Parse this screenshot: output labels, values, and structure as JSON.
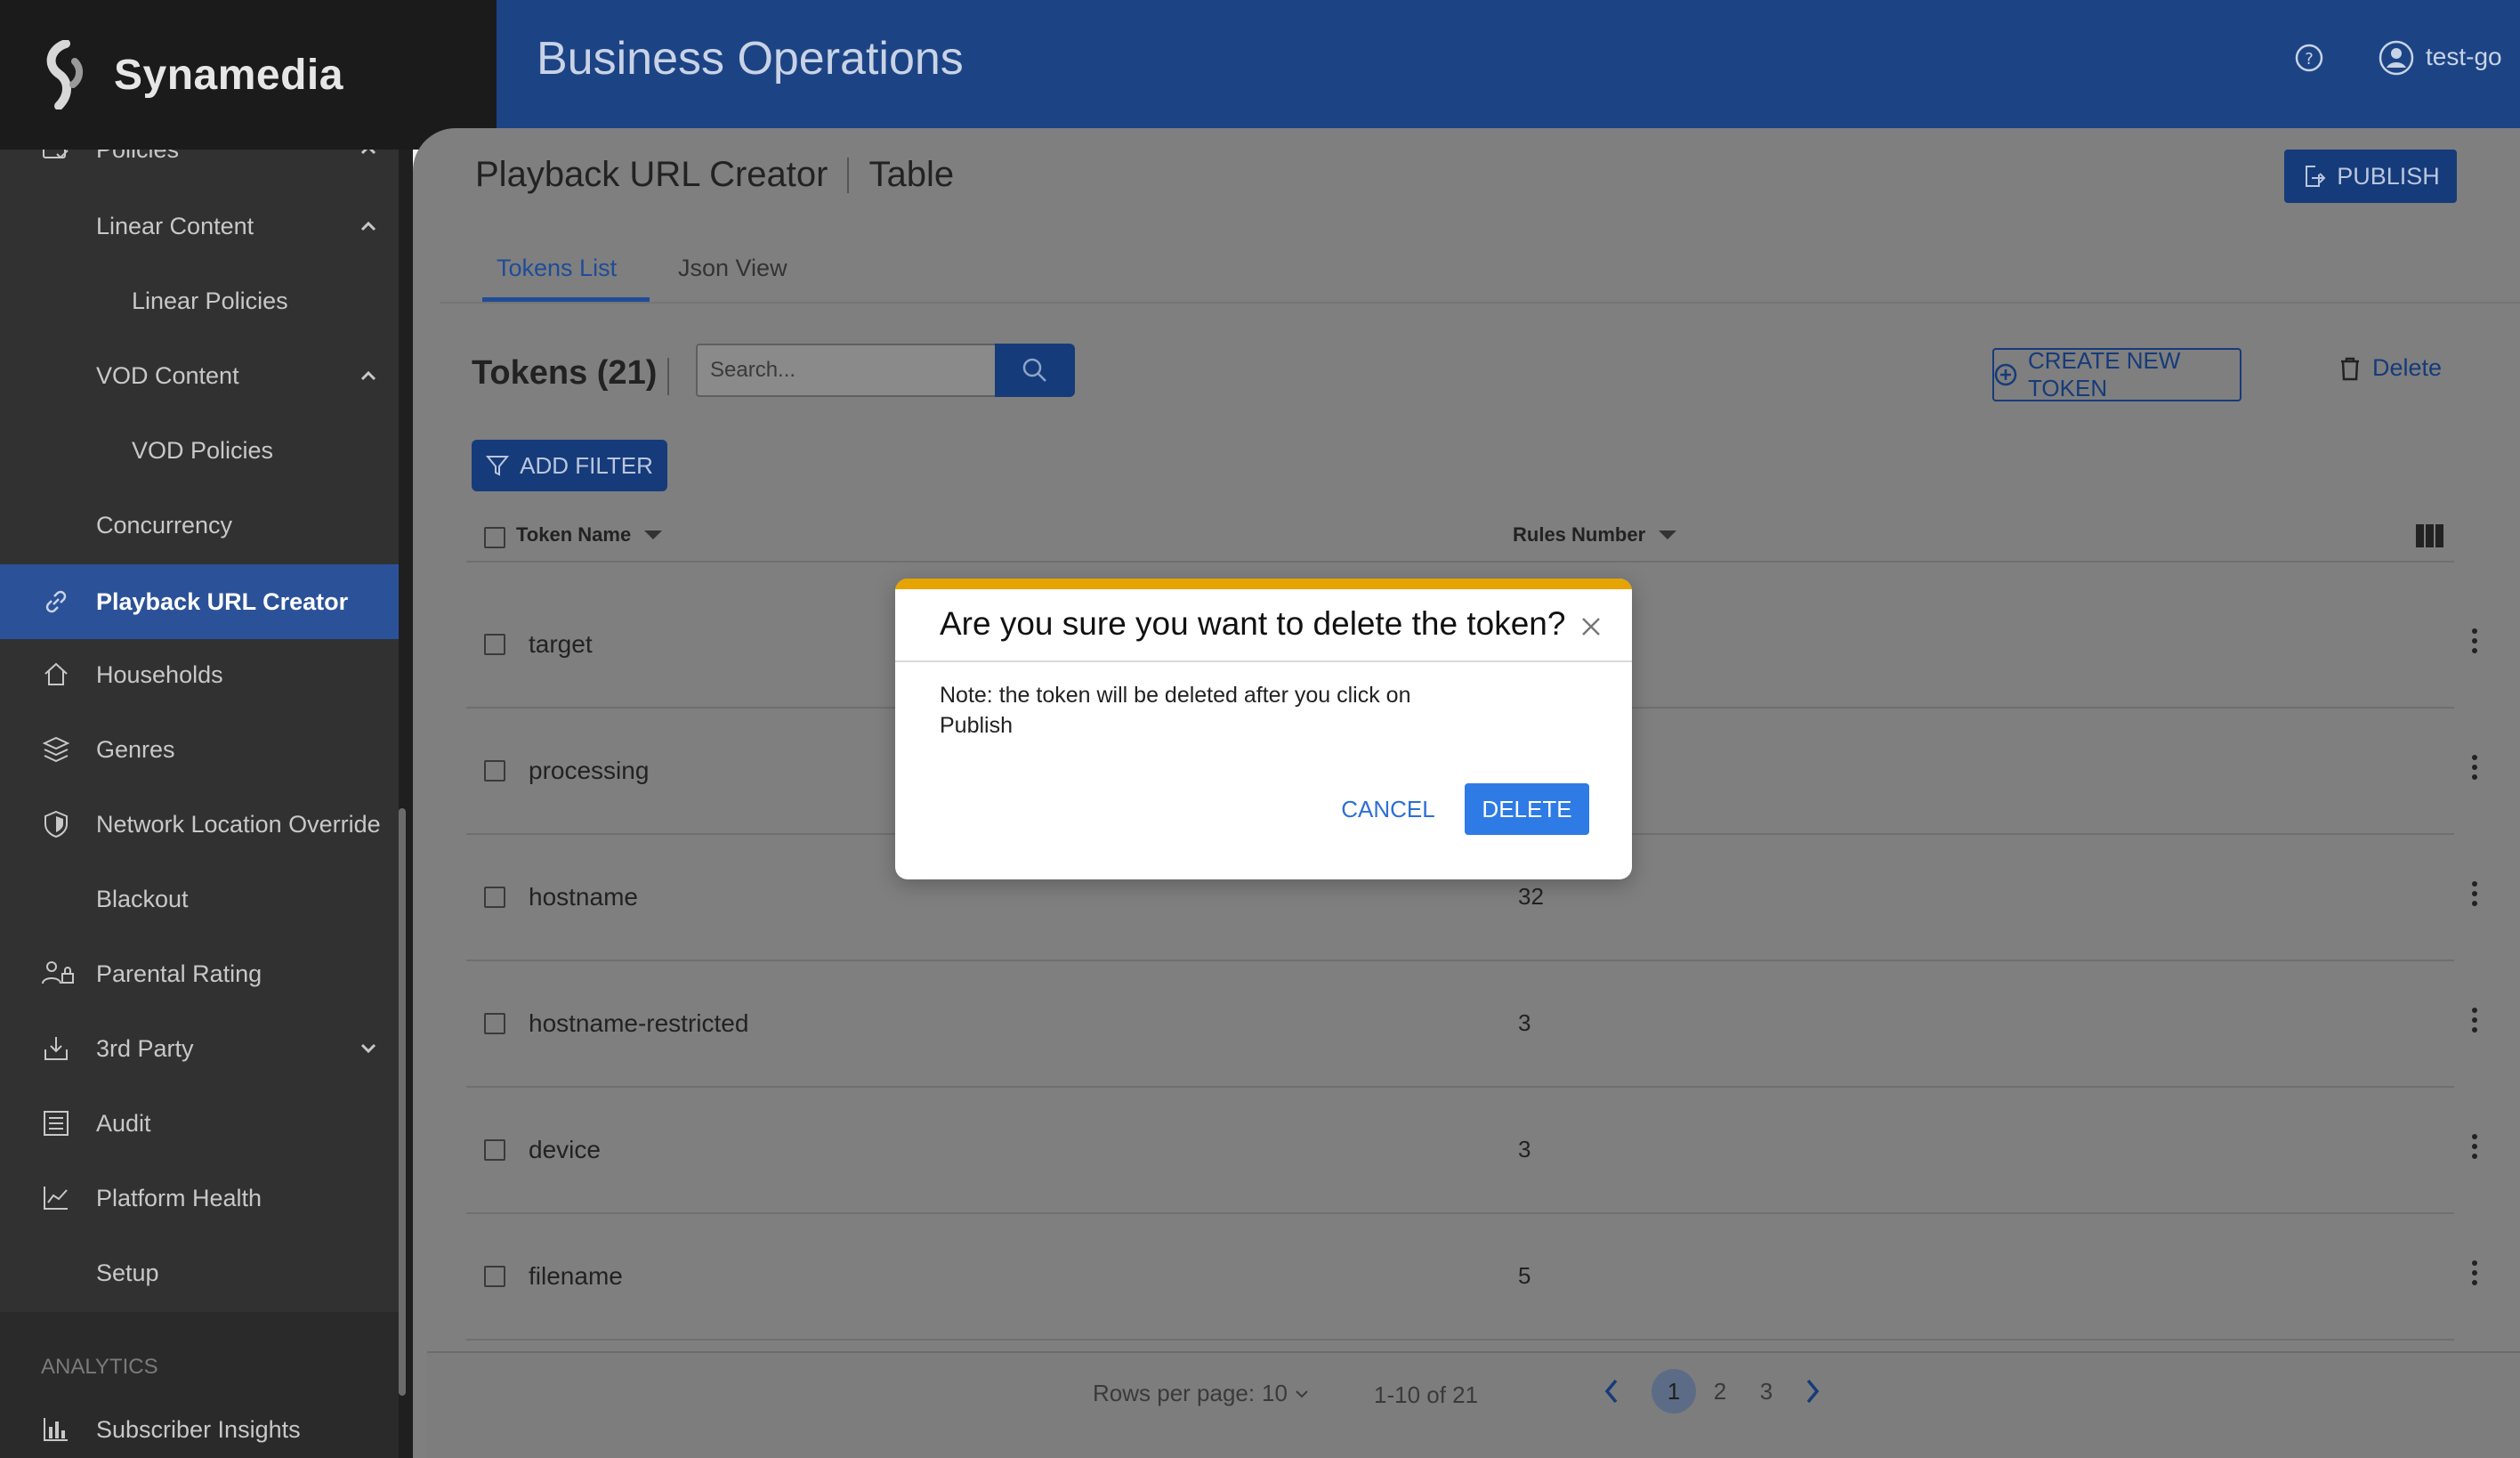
{
  "brand": {
    "name": "Synamedia"
  },
  "header": {
    "app_title": "Business Operations",
    "user_name": "test-go"
  },
  "sidebar": {
    "items": [
      {
        "label": "Policies"
      },
      {
        "label": "Linear Content"
      },
      {
        "label": "Linear Policies"
      },
      {
        "label": "VOD Content"
      },
      {
        "label": "VOD Policies"
      },
      {
        "label": "Concurrency"
      },
      {
        "label": "Playback URL Creator"
      },
      {
        "label": "Households"
      },
      {
        "label": "Genres"
      },
      {
        "label": "Network Location Override"
      },
      {
        "label": "Blackout"
      },
      {
        "label": "Parental Rating"
      },
      {
        "label": "3rd Party"
      },
      {
        "label": "Audit"
      },
      {
        "label": "Platform Health"
      },
      {
        "label": "Setup"
      }
    ],
    "analytics_section": "ANALYTICS",
    "analytics_items": [
      {
        "label": "Subscriber Insights"
      }
    ]
  },
  "page": {
    "title": "Playback URL Creator",
    "view": "Table",
    "publish_label": "PUBLISH",
    "tabs": [
      {
        "label": "Tokens List"
      },
      {
        "label": "Json View"
      }
    ]
  },
  "tokens": {
    "title": "Tokens (21)",
    "search_placeholder": "Search...",
    "create_label": "CREATE NEW TOKEN",
    "delete_label": "Delete",
    "filter_label": "ADD FILTER",
    "columns": {
      "name": "Token Name",
      "rules": "Rules Number"
    },
    "rows": [
      {
        "name": "target",
        "rules": ""
      },
      {
        "name": "processing",
        "rules": ""
      },
      {
        "name": "hostname",
        "rules": "32"
      },
      {
        "name": "hostname-restricted",
        "rules": "3"
      },
      {
        "name": "device",
        "rules": "3"
      },
      {
        "name": "filename",
        "rules": "5"
      }
    ]
  },
  "pagination": {
    "rows_per_page_label": "Rows per page:",
    "rows_per_page": "10",
    "range": "1-10 of 21",
    "pages": [
      "1",
      "2",
      "3"
    ],
    "current_page": "1"
  },
  "dialog": {
    "title": "Are you sure you want to delete the token?",
    "note": "Note: the token will be deleted after you click on Publish",
    "cancel_label": "CANCEL",
    "delete_label": "DELETE",
    "accent": "#e6a400"
  },
  "colors": {
    "brand_blue": "#1c4485",
    "sidebar_bg": "#313131",
    "active_item": "#2b5298",
    "primary_button": "#2e7be6"
  }
}
